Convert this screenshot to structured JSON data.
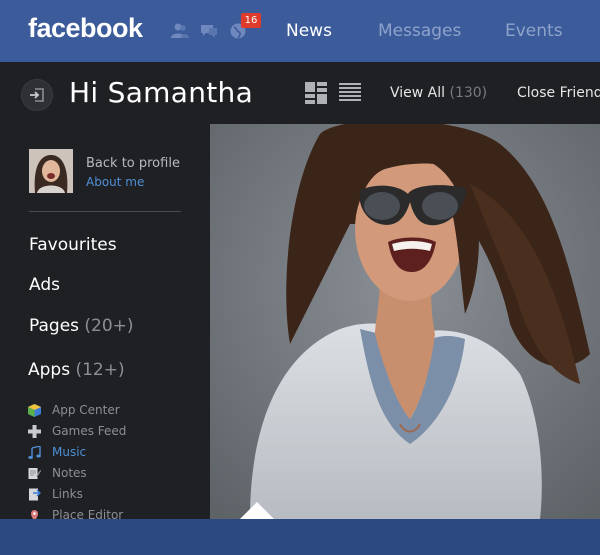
{
  "topbar": {
    "logo": "facebook",
    "notification_count": "16",
    "nav": [
      {
        "label": "News",
        "active": true
      },
      {
        "label": "Messages",
        "active": false
      },
      {
        "label": "Events",
        "active": false
      }
    ]
  },
  "header": {
    "greeting": "Hi Samantha",
    "filters": [
      {
        "label": "View All",
        "count": "(130)"
      },
      {
        "label": "Close Friends",
        "count": ""
      }
    ]
  },
  "profile": {
    "back_label": "Back to profile",
    "about_label": "About me"
  },
  "sidebar": {
    "sections": [
      {
        "label": "Favourites",
        "count": ""
      },
      {
        "label": "Ads",
        "count": ""
      },
      {
        "label": "Pages",
        "count": "(20+)"
      },
      {
        "label": "Apps",
        "count": "(12+)"
      }
    ],
    "apps": [
      {
        "label": "App Center",
        "icon": "app-center-icon",
        "active": false
      },
      {
        "label": "Games Feed",
        "icon": "games-feed-icon",
        "active": false
      },
      {
        "label": "Music",
        "icon": "music-icon",
        "active": true
      },
      {
        "label": "Notes",
        "icon": "notes-icon",
        "active": false
      },
      {
        "label": "Links",
        "icon": "links-icon",
        "active": false
      },
      {
        "label": "Place Editor",
        "icon": "place-editor-icon",
        "active": false
      }
    ]
  },
  "colors": {
    "brand_blue": "#3b5b9a",
    "bottom_bar": "#2c4a80",
    "dark_bg": "#1f2023",
    "link_blue": "#4f8fd6",
    "badge_red": "#dd3b2b"
  }
}
